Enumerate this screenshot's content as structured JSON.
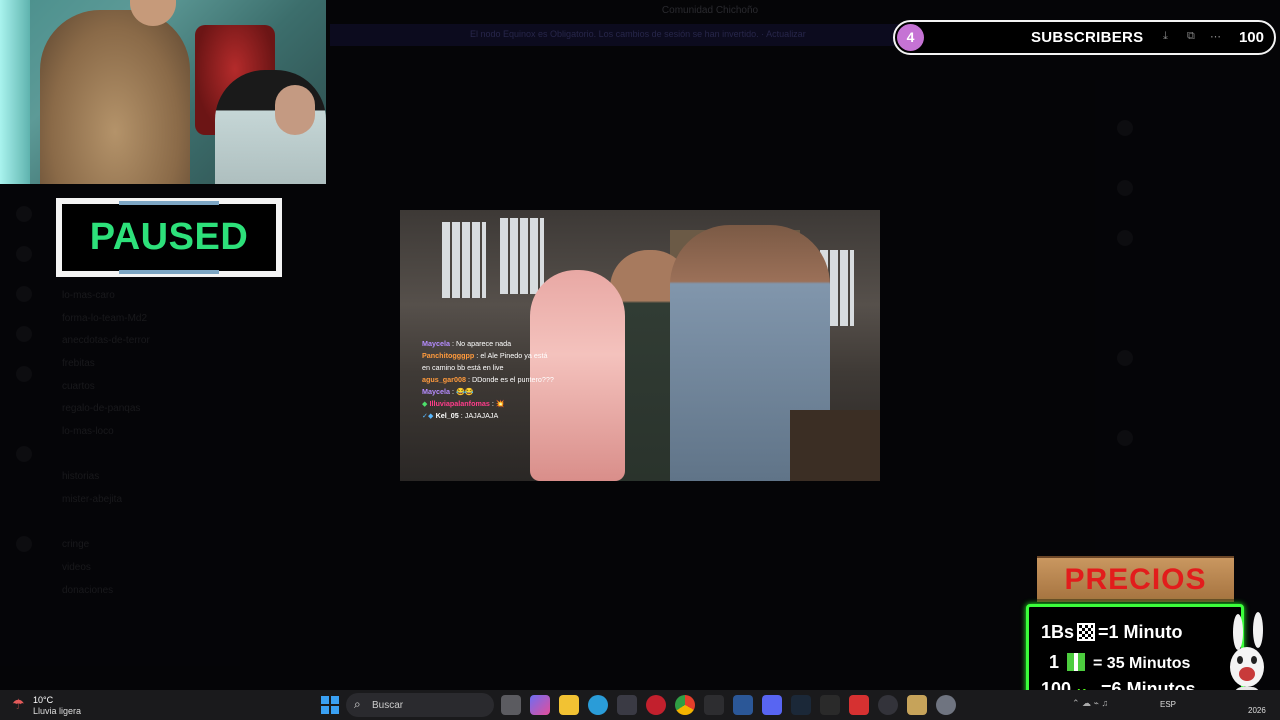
{
  "background_app": {
    "title": "Comunidad Chichoño",
    "banner": "El nodo Equinox es Obligatorio. Los cambios de sesión se han invertido. · Actualizar",
    "channels": [
      "lo-mas-caro",
      "forma-lo-team-Md2",
      "anecdotas-de-terror",
      "frebitas",
      "cuartos",
      "regalo-de-panqas",
      "lo-mas-loco",
      "historias",
      "mister-abejita",
      "cringe",
      "videos",
      "donaciones"
    ]
  },
  "paused": {
    "label": "PAUSED"
  },
  "subscribers": {
    "current": "4",
    "label": "SUBSCRIBERS",
    "goal": "100"
  },
  "chat_overlay": [
    {
      "user": "Maycela",
      "user_color": "#b58cff",
      "message": "No aparece nada"
    },
    {
      "user": "Panchitogggpp",
      "user_color": "#ff9a3c",
      "message": "el Ale Pinedo ya está en camino bb está en live"
    },
    {
      "user": "agus_gar008",
      "user_color": "#ff9a3c",
      "message": "DDonde es el puntero???"
    },
    {
      "user": "Maycela",
      "user_color": "#b58cff",
      "message": "😂😂"
    },
    {
      "user": "Illuviapalanfomas",
      "user_color": "#ff3c8a",
      "message": "💥"
    },
    {
      "user": "Kel_05",
      "user_color": "#ffffff",
      "message": "JAJAJAJA"
    }
  ],
  "precios": {
    "title": "PRECIOS",
    "rows": [
      {
        "amount": "1Bs",
        "icon": "qr-icon",
        "value": "=1 Minuto"
      },
      {
        "amount": "1",
        "icon": "gift-icon",
        "value": "= 35 Minutos"
      },
      {
        "amount": "100",
        "icon": "kick-icon",
        "value": "=6 Minutos"
      }
    ],
    "border_color": "#3bff3b",
    "title_color": "#e21c1c"
  },
  "taskbar": {
    "weather_temp": "10°C",
    "weather_condition": "Lluvia ligera",
    "search_placeholder": "Buscar",
    "language": "ESP",
    "year": "2026"
  }
}
